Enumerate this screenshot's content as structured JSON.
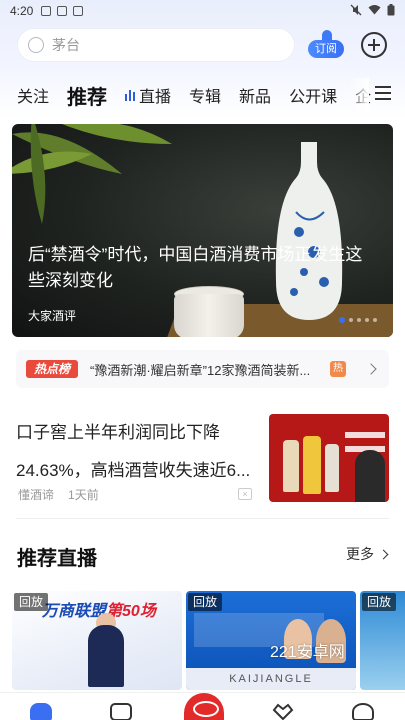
{
  "status_bar": {
    "time": "4:20"
  },
  "search": {
    "placeholder": "茅台"
  },
  "subscribe_label": "订阅",
  "tabs": [
    {
      "label": "关注"
    },
    {
      "label": "推荐"
    },
    {
      "label": "直播"
    },
    {
      "label": "专辑"
    },
    {
      "label": "新品"
    },
    {
      "label": "公开课"
    },
    {
      "label": "企"
    }
  ],
  "active_tab": "推荐",
  "banner": {
    "title": "后“禁酒令”时代，中国白酒消费市场正发生这些深刻变化",
    "source": "大家酒评",
    "slide_count": 5,
    "active_slide": 1
  },
  "hot_list": {
    "badge": "热点榜",
    "text": "“豫酒新潮·耀启新章”12家豫酒简装新...",
    "tag": "热"
  },
  "article": {
    "title": "口子窖上半年利润同比下降24.63%，高档酒营收失速近6...",
    "source": "懂酒谛",
    "time": "1天前",
    "close": "×"
  },
  "live_section": {
    "title": "推荐直播",
    "more": "更多",
    "cards": [
      {
        "badge": "回放",
        "title_a": "万商联盟",
        "title_b": "第50场"
      },
      {
        "badge": "回放",
        "strip": "KAIJIANGLE"
      },
      {
        "badge": "回放"
      }
    ]
  },
  "watermark": "221安卓网",
  "colors": {
    "accent": "#3a6ff2",
    "hot_badge": "#e84a3b",
    "center_nav": "#e32a2a"
  },
  "icons": {
    "search": "search-icon",
    "add": "plus-circle-icon",
    "menu": "hamburger-menu-icon",
    "home": "home-icon",
    "video": "video-play-icon",
    "fav": "heart-diamond-icon",
    "me": "face-icon"
  }
}
